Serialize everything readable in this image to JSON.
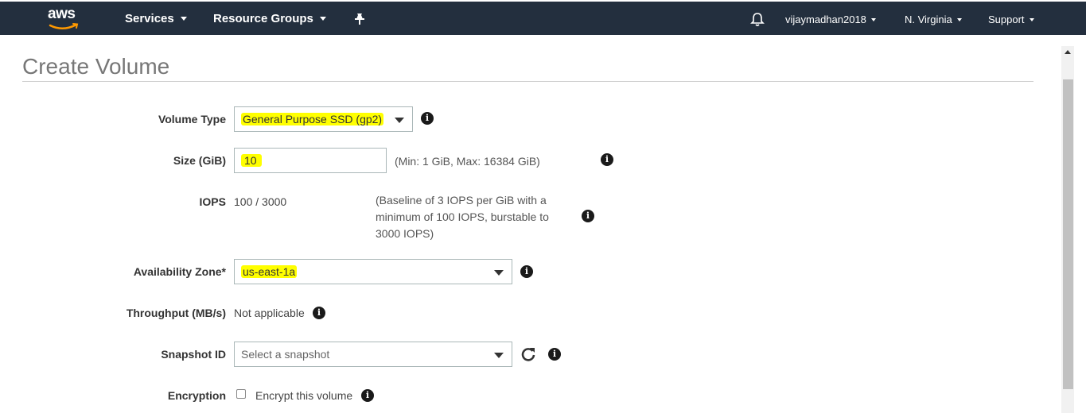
{
  "topnav": {
    "logo": "aws",
    "services": "Services",
    "resource_groups": "Resource Groups",
    "pin_icon": "pin-icon",
    "bell_icon": "bell-icon",
    "user": "vijaymadhan2018",
    "region": "N. Virginia",
    "support": "Support",
    "bg_color": "#232f3e"
  },
  "page": {
    "title": "Create Volume"
  },
  "form": {
    "volume_type": {
      "label": "Volume Type",
      "value": "General Purpose SSD (gp2)"
    },
    "size": {
      "label": "Size (GiB)",
      "value": "10",
      "hint": "(Min: 1 GiB, Max: 16384 GiB)"
    },
    "iops": {
      "label": "IOPS",
      "value": "100 / 3000",
      "hint_line1": "(Baseline of 3 IOPS per GiB with a",
      "hint_line2": "minimum of 100 IOPS, burstable to",
      "hint_line3": "3000 IOPS)"
    },
    "availability_zone": {
      "label": "Availability Zone*",
      "value": "us-east-1a"
    },
    "throughput": {
      "label": "Throughput (MB/s)",
      "value": "Not applicable"
    },
    "snapshot": {
      "label": "Snapshot ID",
      "placeholder": "Select a snapshot"
    },
    "encryption": {
      "label": "Encryption",
      "checkbox_label": "Encrypt this volume",
      "checked": false
    }
  },
  "colors": {
    "highlight": "#ffff00",
    "info_icon": "#1a1a1a"
  }
}
